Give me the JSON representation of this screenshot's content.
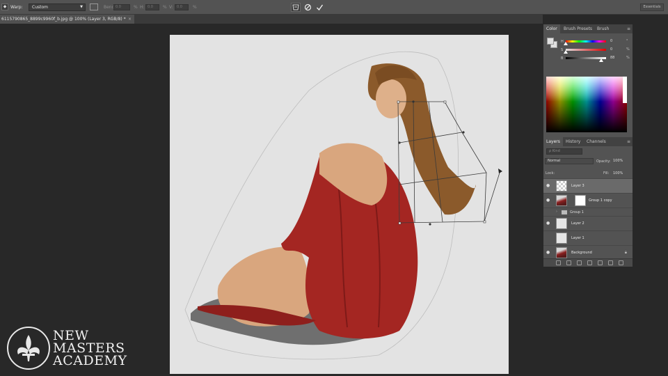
{
  "options_bar": {
    "warp_label": "Warp:",
    "warp_value": "Custom",
    "bend_label": "Bend:",
    "bend_value": "0.0",
    "bend_unit": "%",
    "h_label": "H:",
    "h_value": "0.0",
    "h_unit": "%",
    "v_label": "V:",
    "v_value": "0.0",
    "v_unit": "%",
    "workspace_label": "Essentials"
  },
  "document_tab": {
    "title": "6115790865_8899c9960f_b.jpg @ 100% (Layer 3, RGB/8) *",
    "close": "×"
  },
  "color_panel": {
    "tabs": [
      "Color",
      "Brush Presets",
      "Brush"
    ],
    "menu": "≡",
    "sliders": [
      {
        "label": "H",
        "value": "0",
        "unit": "°",
        "level": 0.0
      },
      {
        "label": "S",
        "value": "0",
        "unit": "%",
        "level": 0.0
      },
      {
        "label": "B",
        "value": "88",
        "unit": "%",
        "level": 0.88
      }
    ],
    "foreground": "#e0e0e0",
    "background": "#e0e0e0"
  },
  "layers_panel": {
    "tabs": [
      "Layers",
      "History",
      "Channels"
    ],
    "menu": "≡",
    "kind_placeholder": "ρ Kind",
    "blend_mode": "Normal",
    "opacity_label": "Opacity:",
    "opacity_value": "100%",
    "lock_label": "Lock:",
    "fill_label": "Fill:",
    "fill_value": "100%",
    "layers": [
      {
        "name": "Layer 3",
        "visible": true,
        "selected": true,
        "thumb": "checker"
      },
      {
        "name": "Group 1 copy",
        "visible": true,
        "selected": false,
        "thumb": "photo",
        "mask": true
      },
      {
        "name": "Group 1",
        "visible": false,
        "selected": false,
        "type": "folder"
      },
      {
        "name": "Layer 2",
        "visible": true,
        "selected": false,
        "thumb": "plain"
      },
      {
        "name": "Layer 1",
        "visible": false,
        "selected": false,
        "thumb": "plain"
      },
      {
        "name": "Background",
        "visible": true,
        "selected": false,
        "thumb": "photo",
        "locked": true
      }
    ]
  },
  "logo": {
    "line1": "NEW",
    "line2": "MASTERS",
    "line3": "ACADEMY"
  }
}
